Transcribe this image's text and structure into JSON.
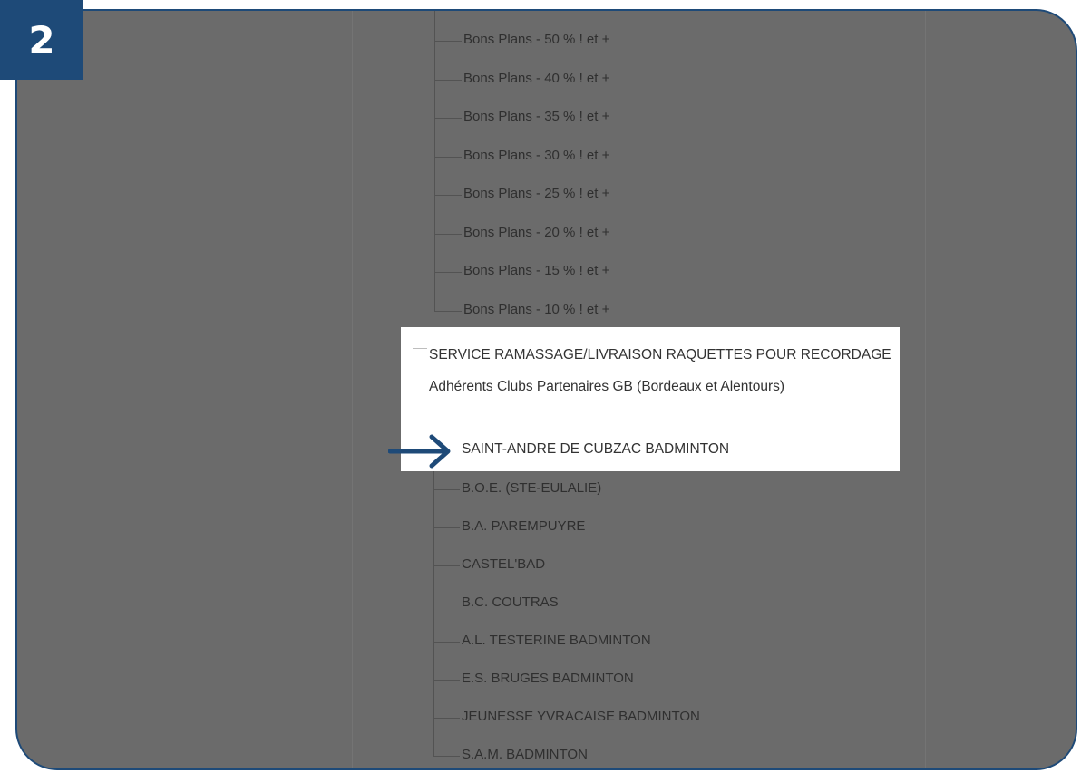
{
  "step": {
    "number": "2"
  },
  "promo_items": [
    "Bons Plans - 50 % ! et +",
    "Bons Plans - 40 % ! et +",
    "Bons Plans - 35 % ! et +",
    "Bons Plans - 30 % ! et +",
    "Bons Plans - 25 % ! et +",
    "Bons Plans - 20 % ! et +",
    "Bons Plans - 15 % ! et +",
    "Bons Plans - 10 % ! et +"
  ],
  "service": {
    "label": "SERVICE RAMASSAGE/LIVRAISON RAQUETTES POUR RECORDAGE Adhérents Clubs Partenaires GB (Bordeaux et Alentours)",
    "highlighted_club": "SAINT-ANDRE DE CUBZAC BADMINTON"
  },
  "clubs": [
    "B.O.E. (STE-EULALIE)",
    "B.A. PAREMPUYRE",
    "CASTEL'BAD",
    "B.C. COUTRAS",
    "A.L. TESTERINE BADMINTON",
    "E.S. BRUGES BADMINTON",
    "JEUNESSE YVRACAISE BADMINTON",
    "S.A.M. BADMINTON"
  ],
  "colors": {
    "accent": "#1e4a78",
    "overlay": "#6b6b6b"
  },
  "icons": {
    "arrow": "arrow-right-icon"
  }
}
